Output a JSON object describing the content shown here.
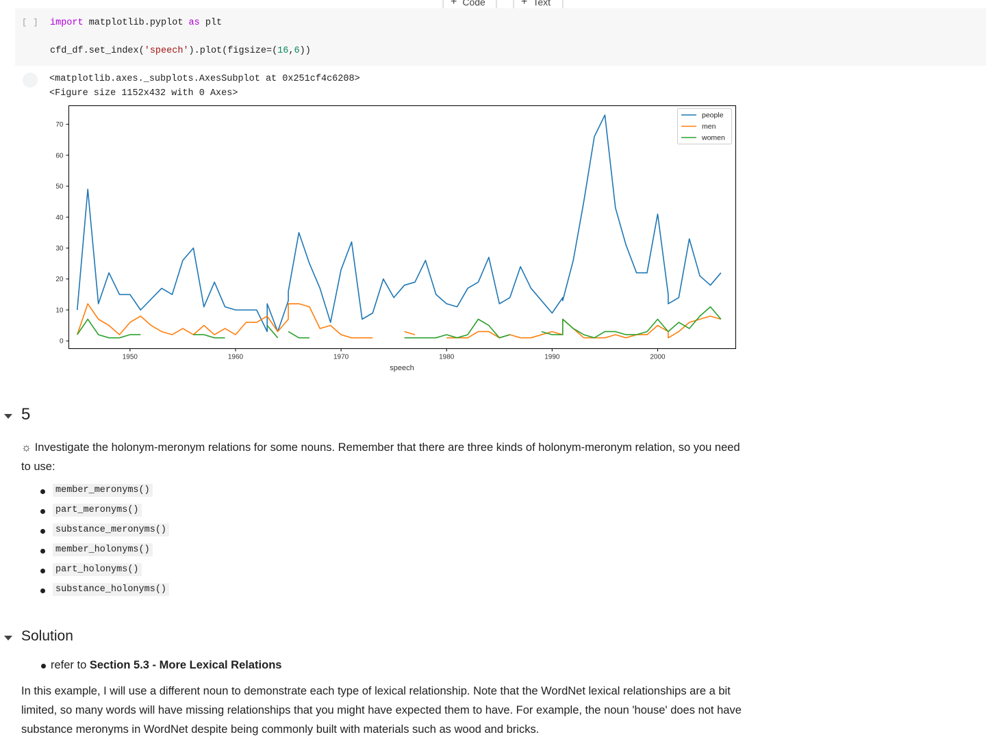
{
  "toolbar": {
    "add_code_label": "Code",
    "add_text_label": "Text",
    "plus_symbol": "+"
  },
  "code_cell": {
    "run_indicator": "[ ]",
    "line1": {
      "kw": "import",
      "rest": " matplotlib.pyplot ",
      "kw2": "as",
      "tail": " plt"
    },
    "line2": {
      "pre": "cfd_df.set_index(",
      "str": "'speech'",
      "mid": ").plot(figsize=(",
      "n1": "16",
      "comma": ",",
      "n2": "6",
      "end": "))"
    }
  },
  "output": {
    "line1": "<matplotlib.axes._subplots.AxesSubplot at 0x251cf4c6208>",
    "line2": "<Figure size 1152x432 with 0 Axes>"
  },
  "chart_data": {
    "type": "line",
    "title": "",
    "xlabel": "speech",
    "ylabel": "",
    "xlim": [
      1944.2,
      2007.4
    ],
    "ylim": [
      -2.5,
      76
    ],
    "xticks": [
      1950,
      1960,
      1970,
      1980,
      1990,
      2000
    ],
    "yticks": [
      0,
      10,
      20,
      30,
      40,
      50,
      60,
      70
    ],
    "grid": false,
    "legend_position": "top-right",
    "colors": {
      "people": "#1f77b4",
      "men": "#ff7f0e",
      "women": "#2ca02c"
    },
    "series": [
      {
        "name": "people",
        "points": [
          [
            1945,
            10
          ],
          [
            1946,
            49
          ],
          [
            1947,
            12
          ],
          [
            1948,
            22
          ],
          [
            1949,
            15
          ],
          [
            1950,
            15
          ],
          [
            1951,
            10
          ],
          [
            1953,
            17
          ],
          [
            1954,
            15
          ],
          [
            1955,
            26
          ],
          [
            1956,
            30
          ],
          [
            1957,
            11
          ],
          [
            1958,
            19
          ],
          [
            1959,
            11
          ],
          [
            1960,
            10
          ],
          [
            1962,
            10
          ],
          [
            1963,
            3
          ],
          [
            1963,
            12
          ],
          [
            1964,
            3
          ],
          [
            1965,
            13
          ],
          [
            1965,
            16
          ],
          [
            1966,
            35
          ],
          [
            1967,
            25
          ],
          [
            1968,
            17
          ],
          [
            1969,
            6
          ],
          [
            1970,
            23
          ],
          [
            1971,
            32
          ],
          [
            1972,
            7
          ],
          [
            1973,
            9
          ],
          [
            1974,
            20
          ],
          [
            1975,
            14
          ],
          [
            1976,
            18
          ],
          [
            1977,
            19
          ],
          [
            1978,
            26
          ],
          [
            1979,
            15
          ],
          [
            1980,
            12
          ],
          [
            1981,
            11
          ],
          [
            1982,
            17
          ],
          [
            1983,
            19
          ],
          [
            1984,
            27
          ],
          [
            1985,
            12
          ],
          [
            1986,
            14
          ],
          [
            1987,
            24
          ],
          [
            1988,
            17
          ],
          [
            1990,
            9
          ],
          [
            1991,
            14
          ],
          [
            1991,
            13
          ],
          [
            1992,
            26
          ],
          [
            1993,
            45
          ],
          [
            1994,
            66
          ],
          [
            1995,
            73
          ],
          [
            1996,
            43
          ],
          [
            1997,
            31
          ],
          [
            1998,
            22
          ],
          [
            1999,
            22
          ],
          [
            2000,
            41
          ],
          [
            2001,
            15
          ],
          [
            2001,
            12
          ],
          [
            2002,
            14
          ],
          [
            2003,
            33
          ],
          [
            2004,
            21
          ],
          [
            2005,
            18
          ],
          [
            2006,
            22
          ]
        ]
      },
      {
        "name": "men",
        "segments": [
          [
            [
              1945,
              2
            ],
            [
              1946,
              12
            ],
            [
              1947,
              7
            ],
            [
              1948,
              5
            ],
            [
              1949,
              2
            ],
            [
              1950,
              6
            ],
            [
              1951,
              8
            ],
            [
              1952,
              5
            ],
            [
              1953,
              3
            ],
            [
              1954,
              2
            ],
            [
              1955,
              4
            ],
            [
              1956,
              2
            ],
            [
              1957,
              5
            ],
            [
              1958,
              2
            ],
            [
              1959,
              4
            ],
            [
              1960,
              2
            ],
            [
              1961,
              6
            ],
            [
              1962,
              6
            ],
            [
              1963,
              8
            ],
            [
              1964,
              3
            ],
            [
              1965,
              7
            ],
            [
              1965,
              12
            ],
            [
              1966,
              12
            ],
            [
              1967,
              11
            ],
            [
              1968,
              4
            ],
            [
              1969,
              5
            ],
            [
              1970,
              2
            ],
            [
              1971,
              1
            ],
            [
              1973,
              1
            ]
          ],
          [
            [
              1976,
              3
            ],
            [
              1977,
              2
            ]
          ],
          [
            [
              1980,
              1
            ],
            [
              1981,
              1
            ],
            [
              1982,
              1
            ],
            [
              1983,
              3
            ],
            [
              1984,
              3
            ],
            [
              1985,
              1
            ],
            [
              1986,
              2
            ],
            [
              1987,
              1
            ],
            [
              1988,
              1
            ],
            [
              1990,
              3
            ],
            [
              1991,
              2
            ],
            [
              1991,
              7
            ],
            [
              1992,
              4
            ],
            [
              1993,
              1
            ],
            [
              1995,
              1
            ],
            [
              1996,
              2
            ],
            [
              1997,
              1
            ],
            [
              1998,
              2
            ],
            [
              1999,
              2
            ],
            [
              2000,
              5
            ],
            [
              2001,
              3
            ],
            [
              2001,
              1
            ],
            [
              2002,
              3
            ],
            [
              2003,
              6
            ],
            [
              2004,
              7
            ],
            [
              2005,
              8
            ],
            [
              2006,
              7
            ]
          ]
        ]
      },
      {
        "name": "women",
        "segments": [
          [
            [
              1945,
              2
            ],
            [
              1946,
              7
            ],
            [
              1947,
              2
            ],
            [
              1948,
              1
            ],
            [
              1949,
              1
            ],
            [
              1950,
              2
            ],
            [
              1951,
              2
            ]
          ],
          [
            [
              1956,
              2
            ],
            [
              1957,
              2
            ],
            [
              1958,
              1
            ],
            [
              1959,
              1
            ]
          ],
          [
            [
              1963,
              5
            ],
            [
              1964,
              1
            ]
          ],
          [
            [
              1965,
              3
            ],
            [
              1966,
              1
            ],
            [
              1967,
              1
            ]
          ],
          [
            [
              1976,
              1
            ],
            [
              1979,
              1
            ],
            [
              1980,
              2
            ],
            [
              1981,
              1
            ],
            [
              1982,
              2
            ],
            [
              1983,
              7
            ],
            [
              1984,
              5
            ],
            [
              1985,
              1
            ],
            [
              1986,
              2
            ]
          ],
          [
            [
              1989,
              3
            ],
            [
              1990,
              2
            ],
            [
              1991,
              2
            ],
            [
              1991,
              7
            ],
            [
              1992,
              4
            ],
            [
              1993,
              2
            ],
            [
              1994,
              1
            ],
            [
              1995,
              3
            ],
            [
              1996,
              3
            ],
            [
              1997,
              2
            ],
            [
              1998,
              2
            ],
            [
              1999,
              3
            ],
            [
              2000,
              7
            ],
            [
              2001,
              3
            ],
            [
              2002,
              6
            ],
            [
              2003,
              4
            ],
            [
              2004,
              8
            ],
            [
              2005,
              11
            ],
            [
              2006,
              7
            ]
          ]
        ]
      }
    ]
  },
  "section5": {
    "heading": "5",
    "intro_icon": "☼",
    "intro": " Investigate the holonym-meronym relations for some nouns. Remember that there are three kinds of holonym-meronym relation, so you need",
    "intro_cont": "to use:",
    "methods": [
      "member_meronyms()",
      "part_meronyms()",
      "substance_meronyms()",
      "member_holonyms()",
      "part_holonyms()",
      "substance_holonyms()"
    ]
  },
  "solution": {
    "heading": "Solution",
    "ref_prefix": "refer to ",
    "ref_bold": "Section 5.3 - More Lexical Relations",
    "para_line1": "In this example, I will use a different noun to demonstrate each type of lexical relationship. Note that the WordNet lexical relationships are a bit",
    "para_line2": "limited, so many words will have missing relationships that you might have expected them to have. For example, the noun 'house' does not have",
    "para_line3": "substance meronyms in WordNet despite being commonly built with materials such as wood and bricks."
  }
}
